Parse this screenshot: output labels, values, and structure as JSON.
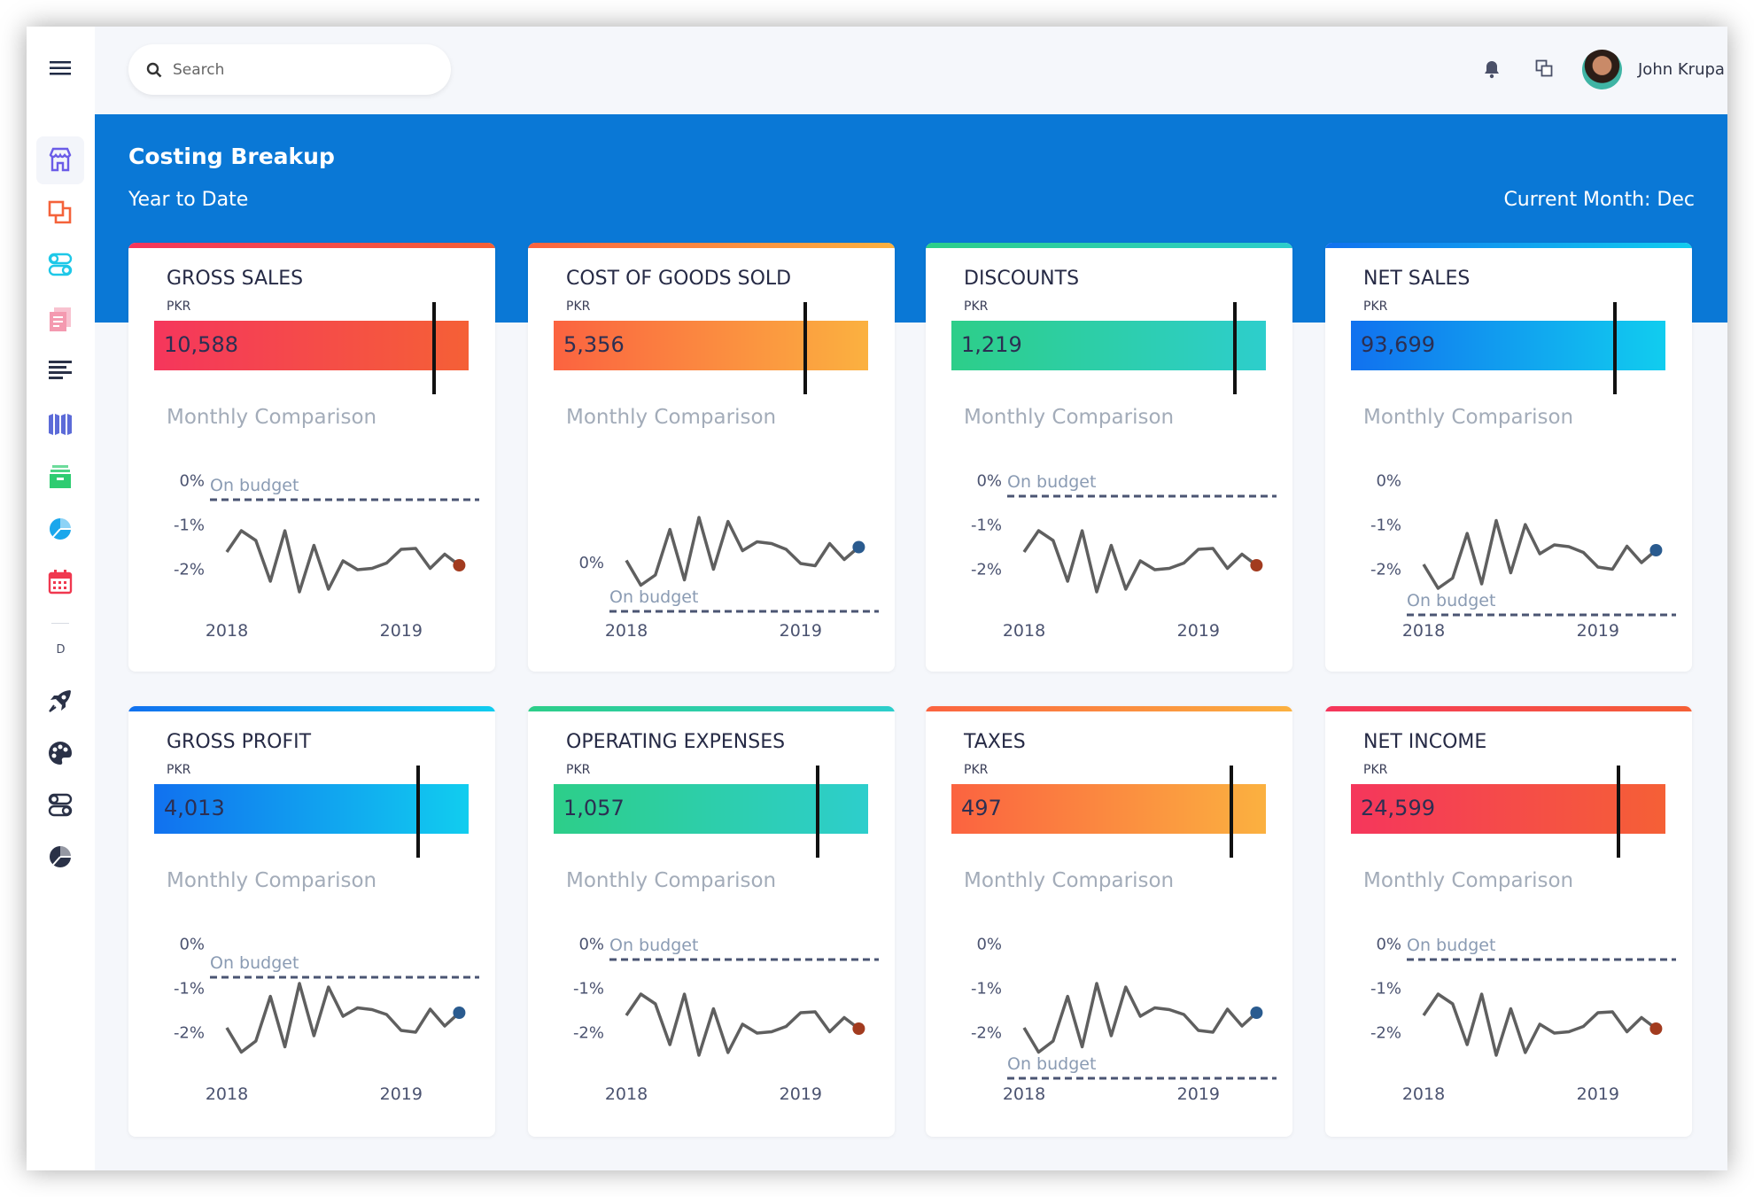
{
  "sidebar": {
    "items": [
      {
        "icon": "store-icon",
        "color": "#6b5ce7",
        "active": true
      },
      {
        "icon": "copy-icon",
        "color": "#f4623a"
      },
      {
        "icon": "toggles-icon",
        "color": "#1ec8e8"
      },
      {
        "icon": "document-icon",
        "color": "#f49ab0"
      },
      {
        "icon": "align-left-icon",
        "color": "#2a3147"
      },
      {
        "icon": "columns-icon",
        "color": "#5c6bd8"
      },
      {
        "icon": "archive-icon",
        "color": "#2ecc71"
      },
      {
        "icon": "pie-chart-icon",
        "color": "#1aa7ec"
      },
      {
        "icon": "calendar-icon",
        "color": "#f0384f"
      }
    ],
    "section_label": "D",
    "items2": [
      {
        "icon": "rocket-icon",
        "color": "#2a3147"
      },
      {
        "icon": "palette-icon",
        "color": "#2a3147"
      },
      {
        "icon": "toggles-icon",
        "color": "#2a3147"
      },
      {
        "icon": "pie-chart-icon",
        "color": "#2a3147"
      }
    ]
  },
  "header": {
    "search_placeholder": "Search",
    "user_name": "John Krupa"
  },
  "band": {
    "title": "Costing Breakup",
    "subtitle": "Year to Date",
    "current_month": "Current Month: Dec",
    "color": "#0a78d6"
  },
  "common": {
    "currency": "PKR",
    "section": "Monthly Comparison",
    "ref_label": "On budget"
  },
  "chart_data": [
    {
      "type": "line",
      "title": "GROSS SALES",
      "value": "10,588",
      "target_fraction": 0.89,
      "gradient": [
        "#f5365c",
        "#f56036"
      ],
      "dot_color": "#a23b1f",
      "yticks": [
        "0%",
        "-1%",
        "-2%"
      ],
      "ytick_values": [
        0,
        -1,
        -2
      ],
      "ylim": [
        -3.2,
        0.25
      ],
      "budget": -0.43,
      "xticks": [
        {
          "label": "2018",
          "index": 0
        },
        {
          "label": "2019",
          "index": 12
        }
      ],
      "values": [
        -1.61,
        -1.13,
        -1.35,
        -2.27,
        -1.13,
        -2.51,
        -1.46,
        -2.45,
        -1.81,
        -2.01,
        -1.98,
        -1.86,
        -1.55,
        -1.53,
        -1.98,
        -1.66,
        -1.91
      ]
    },
    {
      "type": "line",
      "title": "COST OF GOODS SOLD",
      "value": "5,356",
      "target_fraction": 0.8,
      "gradient": [
        "#fb6340",
        "#fbb140"
      ],
      "dot_color": "#2a5b8f",
      "yticks": [
        "0%"
      ],
      "ytick_values": [
        0
      ],
      "ylim": [
        -1.35,
        2.1
      ],
      "budget": -1.1,
      "xticks": [
        {
          "label": "2018",
          "index": 0
        },
        {
          "label": "2019",
          "index": 12
        }
      ],
      "values": [
        0.05,
        -0.51,
        -0.28,
        0.75,
        -0.39,
        1.02,
        -0.15,
        0.93,
        0.27,
        0.47,
        0.43,
        0.3,
        -0.02,
        -0.07,
        0.43,
        0.07,
        0.35
      ]
    },
    {
      "type": "line",
      "title": "DISCOUNTS",
      "value": "1,219",
      "target_fraction": 0.9,
      "gradient": [
        "#2dce89",
        "#2dcecc"
      ],
      "dot_color": "#a23b1f",
      "yticks": [
        "0%",
        "-1%",
        "-2%"
      ],
      "ytick_values": [
        0,
        -1,
        -2
      ],
      "ylim": [
        -3.2,
        0.25
      ],
      "budget": -0.35,
      "xticks": [
        {
          "label": "2018",
          "index": 0
        },
        {
          "label": "2019",
          "index": 12
        }
      ],
      "values": [
        -1.61,
        -1.13,
        -1.35,
        -2.27,
        -1.13,
        -2.51,
        -1.46,
        -2.45,
        -1.81,
        -2.01,
        -1.98,
        -1.86,
        -1.55,
        -1.53,
        -1.98,
        -1.66,
        -1.91
      ]
    },
    {
      "type": "line",
      "title": "NET SALES",
      "value": "93,699",
      "target_fraction": 0.84,
      "gradient": [
        "#1171ef",
        "#11cdef"
      ],
      "dot_color": "#2a5b8f",
      "yticks": [
        "0%",
        "-1%",
        "-2%"
      ],
      "ytick_values": [
        0,
        -1,
        -2
      ],
      "ylim": [
        -3.2,
        0.25
      ],
      "budget": -3.03,
      "xticks": [
        {
          "label": "2018",
          "index": 0
        },
        {
          "label": "2019",
          "index": 12
        }
      ],
      "values": [
        -1.89,
        -2.43,
        -2.2,
        -1.19,
        -2.33,
        -0.9,
        -2.08,
        -0.99,
        -1.65,
        -1.45,
        -1.49,
        -1.62,
        -1.95,
        -2.0,
        -1.48,
        -1.85,
        -1.57
      ]
    },
    {
      "type": "line",
      "title": "GROSS PROFIT",
      "value": "4,013",
      "target_fraction": 0.84,
      "gradient": [
        "#1171ef",
        "#11cdef"
      ],
      "dot_color": "#2a5b8f",
      "yticks": [
        "0%",
        "-1%",
        "-2%"
      ],
      "ytick_values": [
        0,
        -1,
        -2
      ],
      "ylim": [
        -3.2,
        0.25
      ],
      "budget": -0.75,
      "xticks": [
        {
          "label": "2018",
          "index": 0
        },
        {
          "label": "2019",
          "index": 12
        }
      ],
      "values": [
        -1.89,
        -2.44,
        -2.19,
        -1.18,
        -2.32,
        -0.89,
        -2.07,
        -0.97,
        -1.63,
        -1.44,
        -1.48,
        -1.59,
        -1.95,
        -1.99,
        -1.47,
        -1.85,
        -1.55
      ]
    },
    {
      "type": "line",
      "title": "OPERATING EXPENSES",
      "value": "1,057",
      "target_fraction": 0.84,
      "gradient": [
        "#2dce89",
        "#2dcecc"
      ],
      "dot_color": "#a23b1f",
      "yticks": [
        "0%",
        "-1%",
        "-2%"
      ],
      "ytick_values": [
        0,
        -1,
        -2
      ],
      "ylim": [
        -3.2,
        0.25
      ],
      "budget": -0.35,
      "xticks": [
        {
          "label": "2018",
          "index": 0
        },
        {
          "label": "2019",
          "index": 12
        }
      ],
      "values": [
        -1.61,
        -1.13,
        -1.35,
        -2.27,
        -1.13,
        -2.51,
        -1.46,
        -2.45,
        -1.81,
        -2.01,
        -1.98,
        -1.86,
        -1.55,
        -1.53,
        -1.98,
        -1.66,
        -1.91
      ]
    },
    {
      "type": "line",
      "title": "TAXES",
      "value": "497",
      "target_fraction": 0.89,
      "gradient": [
        "#fb6340",
        "#fbb140"
      ],
      "dot_color": "#2a5b8f",
      "yticks": [
        "0%",
        "-1%",
        "-2%"
      ],
      "ytick_values": [
        0,
        -1,
        -2
      ],
      "ylim": [
        -3.2,
        0.25
      ],
      "budget": -3.03,
      "xticks": [
        {
          "label": "2018",
          "index": 0
        },
        {
          "label": "2019",
          "index": 12
        }
      ],
      "values": [
        -1.89,
        -2.44,
        -2.19,
        -1.18,
        -2.32,
        -0.89,
        -2.07,
        -0.97,
        -1.63,
        -1.44,
        -1.48,
        -1.59,
        -1.95,
        -1.99,
        -1.47,
        -1.85,
        -1.55
      ]
    },
    {
      "type": "line",
      "title": "NET INCOME",
      "value": "24,599",
      "target_fraction": 0.85,
      "gradient": [
        "#f5365c",
        "#f56036"
      ],
      "dot_color": "#a23b1f",
      "yticks": [
        "0%",
        "-1%",
        "-2%"
      ],
      "ytick_values": [
        0,
        -1,
        -2
      ],
      "ylim": [
        -3.2,
        0.25
      ],
      "budget": -0.35,
      "xticks": [
        {
          "label": "2018",
          "index": 0
        },
        {
          "label": "2019",
          "index": 12
        }
      ],
      "values": [
        -1.61,
        -1.13,
        -1.35,
        -2.27,
        -1.13,
        -2.51,
        -1.46,
        -2.45,
        -1.81,
        -2.01,
        -1.98,
        -1.86,
        -1.55,
        -1.53,
        -1.98,
        -1.66,
        -1.91
      ]
    }
  ]
}
